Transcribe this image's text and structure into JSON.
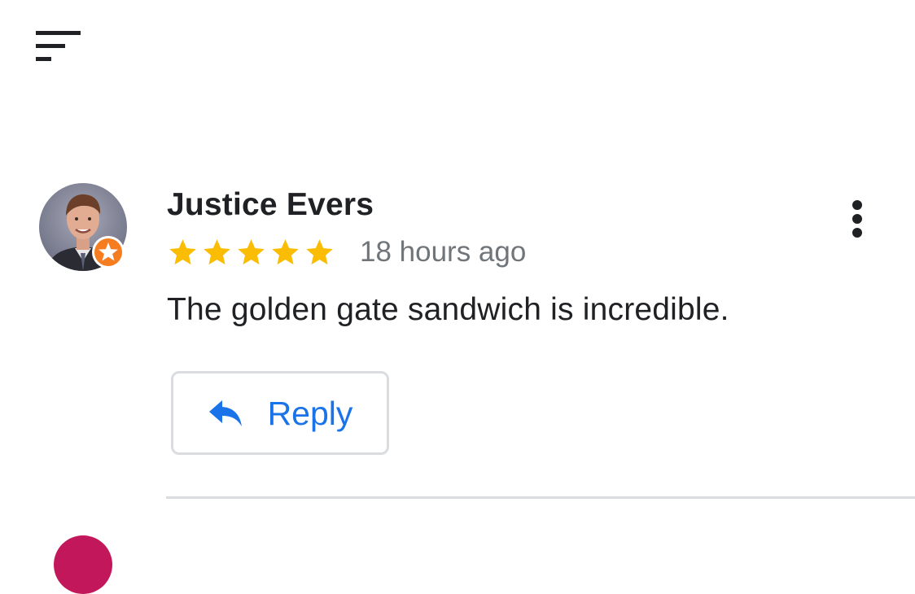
{
  "toolbar": {
    "sort_icon": "sort-lines-icon"
  },
  "review": {
    "reviewer_name": "Justice Evers",
    "badge_icon": "local-guide-star-icon",
    "rating": 5,
    "rating_max": 5,
    "timestamp": "18 hours ago",
    "text": "The golden gate sandwich is incredible.",
    "menu_icon": "more-vert-icon",
    "reply_label": "Reply",
    "reply_icon": "reply-arrow-icon"
  },
  "colors": {
    "star": "#fbbc04",
    "reply_accent": "#1a73e8",
    "badge": "#f57c1f",
    "divider": "#dadce0",
    "next_avatar": "#c2185b"
  }
}
